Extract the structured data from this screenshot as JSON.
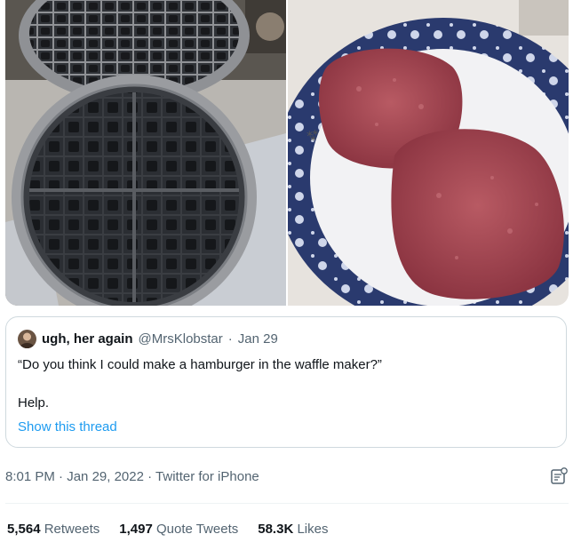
{
  "media": {
    "photos": [
      {
        "icon": "waffle-maker-photo"
      },
      {
        "icon": "hamburger-patties-photo"
      }
    ]
  },
  "quote": {
    "avatar_icon": "avatar-icon",
    "name": "ugh, her again",
    "handle": "@MrsKlobstar",
    "separator": "·",
    "date": "Jan 29",
    "text": "“Do you think I could make a hamburger in the waffle maker?”",
    "text2": "Help.",
    "link": "Show this thread"
  },
  "meta": {
    "time": "8:01 PM",
    "sep1": "·",
    "date": "Jan 29, 2022",
    "sep2": "·",
    "source": "Twitter for iPhone",
    "analytics_icon": "analytics-icon"
  },
  "stats": {
    "retweets_num": "5,564",
    "retweets_label": "Retweets",
    "quotes_num": "1,497",
    "quotes_label": "Quote Tweets",
    "likes_num": "58.3K",
    "likes_label": "Likes"
  },
  "colors": {
    "accent": "#1d9bf0",
    "secondary_text": "#536471",
    "border": "#cfd9de"
  }
}
